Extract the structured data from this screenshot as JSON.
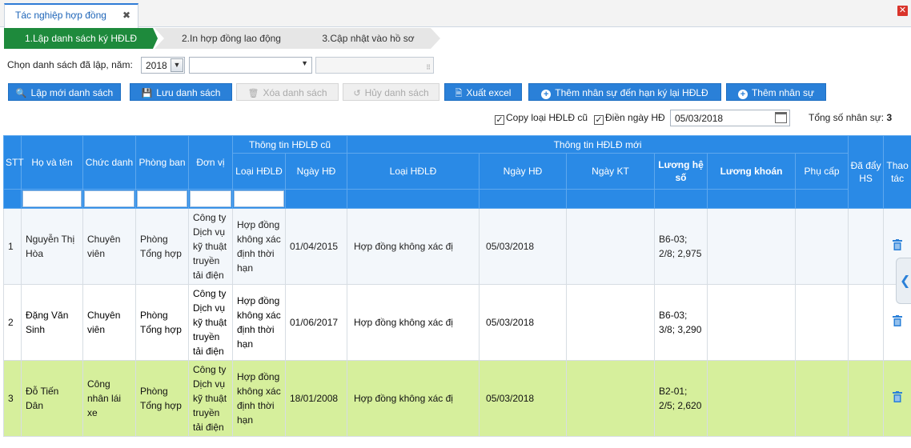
{
  "tab": {
    "title": "Tác nghiệp hợp đồng",
    "close": "✖"
  },
  "window_close": "✕",
  "steps": [
    {
      "label": "1.Lập danh sách ký HĐLĐ"
    },
    {
      "label": "2.In hợp đồng lao động"
    },
    {
      "label": "3.Cập nhật vào hồ sơ"
    }
  ],
  "filter": {
    "label": "Chọn danh sách đã lập, năm:",
    "year": "2018",
    "list_value": "",
    "extra_value": ""
  },
  "toolbar": {
    "create_new": "Lập mới danh sách",
    "save": "Lưu danh sách",
    "delete": "Xóa danh sách",
    "cancel": "Hủy danh sách",
    "export": "Xuất excel",
    "add_due": "Thêm nhân sự đến hạn ký lại HĐLĐ",
    "add_staff": "Thêm nhân sự"
  },
  "options": {
    "copy_label": "Copy loại HĐLĐ cũ",
    "fill_date_label": "Điền ngày HĐ",
    "date_value": "05/03/2018",
    "total_label": "Tổng số nhân sự:",
    "total_value": "3"
  },
  "columns": {
    "stt": "STT",
    "name": "Họ và tên",
    "title": "Chức danh",
    "dept": "Phòng ban",
    "unit": "Đơn vị",
    "old_group": "Thông tin HĐLĐ cũ",
    "old_type": "Loại HĐLĐ",
    "old_date": "Ngày HĐ",
    "new_group": "Thông tin HĐLĐ mới",
    "new_type": "Loại HĐLĐ",
    "new_date": "Ngày HĐ",
    "end_date": "Ngày KT",
    "coef": "Lương hệ số",
    "lump": "Lương khoán",
    "allowance": "Phụ cấp",
    "pushed": "Đã đẩy HS",
    "actions": "Thao tác"
  },
  "rows": [
    {
      "stt": "1",
      "name": "Nguyễn Thị Hòa",
      "title": "Chuyên viên",
      "dept": "Phòng Tổng hợp",
      "unit": "Công ty Dịch vụ kỹ thuật truyền tải điện",
      "old_type": "Hợp đồng không xác định thời hạn",
      "old_date": "01/04/2015",
      "new_type": "Hợp đồng không xác đị",
      "new_date": "05/03/2018",
      "end_date": "",
      "coef": "B6-03; 2/8; 2,975",
      "lump": "",
      "allowance": "",
      "pushed": ""
    },
    {
      "stt": "2",
      "name": "Đặng Văn Sinh",
      "title": "Chuyên viên",
      "dept": "Phòng Tổng hợp",
      "unit": "Công ty Dịch vụ kỹ thuật truyền tải điện",
      "old_type": "Hợp đồng không xác định thời hạn",
      "old_date": "01/06/2017",
      "new_type": "Hợp đồng không xác đị",
      "new_date": "05/03/2018",
      "end_date": "",
      "coef": "B6-03; 3/8; 3,290",
      "lump": "",
      "allowance": "",
      "pushed": ""
    },
    {
      "stt": "3",
      "name": "Đỗ Tiến Dân",
      "title": "Công nhân lái xe",
      "dept": "Phòng Tổng hợp",
      "unit": "Công ty Dịch vụ kỹ thuật truyền tải điện",
      "old_type": "Hợp đồng không xác định thời hạn",
      "old_date": "18/01/2008",
      "new_type": "Hợp đồng không xác đị",
      "new_date": "05/03/2018",
      "end_date": "",
      "coef": "B2-01; 2/5; 2,620",
      "lump": "",
      "allowance": "",
      "pushed": ""
    }
  ],
  "colors": {
    "accent": "#2a8ae6",
    "step_active": "#1e8a3c",
    "row_selected": "#d6ef9c"
  }
}
